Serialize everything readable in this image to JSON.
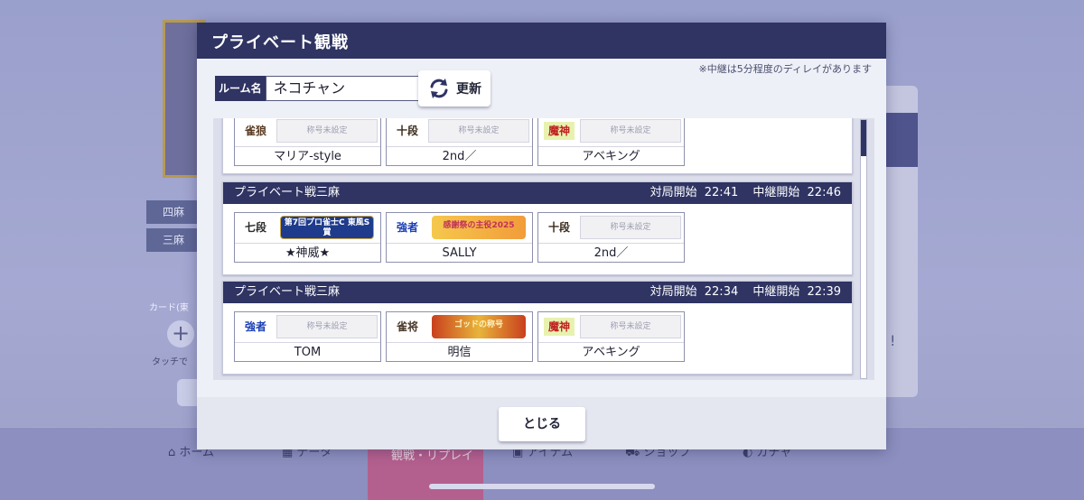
{
  "background": {
    "tags": [
      "四麻",
      "三麻"
    ],
    "card_label": "カード(東",
    "touch_hint": "タッチで",
    "nav": [
      {
        "label": "ホーム",
        "icon": "home-icon"
      },
      {
        "label": "データ",
        "icon": "data-icon"
      },
      {
        "label": "観戦・リプレイ",
        "icon": "spectate-icon"
      },
      {
        "label": "アイテム",
        "icon": "item-icon"
      },
      {
        "label": "ショップ",
        "icon": "shop-icon"
      },
      {
        "label": "ガチャ",
        "icon": "gacha-icon"
      }
    ]
  },
  "modal": {
    "title": "プライベート観戦",
    "delay_note": "※中継は5分程度のディレイがあります",
    "room_label": "ルーム名",
    "room_value": "ネコチャン",
    "refresh_label": "更新",
    "close_label": "とじる",
    "colors": {
      "header": "#2f3463",
      "panel": "#eef0f7"
    }
  },
  "matches": [
    {
      "name": "",
      "start_label": "",
      "start_time": "",
      "relay_label": "",
      "relay_time": "",
      "players": [
        {
          "rank": "雀狼",
          "title": "称号未設定",
          "name": "マリア-style"
        },
        {
          "rank": "十段",
          "title": "称号未設定",
          "name": "2nd／"
        },
        {
          "rank": "魔神",
          "title": "称号未設定",
          "name": "アベキング"
        }
      ]
    },
    {
      "name": "プライベート戦三麻",
      "start_label": "対局開始",
      "start_time": "22:41",
      "relay_label": "中継開始",
      "relay_time": "22:46",
      "players": [
        {
          "rank": "七段",
          "title": "第7回プロ雀士C 東風S賞",
          "name": "★神威★"
        },
        {
          "rank": "強者",
          "title": "感謝祭の主役2025",
          "name": "SALLY"
        },
        {
          "rank": "十段",
          "title": "称号未設定",
          "name": "2nd／"
        }
      ]
    },
    {
      "name": "プライベート戦三麻",
      "start_label": "対局開始",
      "start_time": "22:34",
      "relay_label": "中継開始",
      "relay_time": "22:39",
      "players": [
        {
          "rank": "強者",
          "title": "称号未設定",
          "name": "TOM"
        },
        {
          "rank": "雀将",
          "title": "ゴッドの称号",
          "name": "明信"
        },
        {
          "rank": "魔神",
          "title": "称号未設定",
          "name": "アベキング"
        }
      ]
    }
  ]
}
